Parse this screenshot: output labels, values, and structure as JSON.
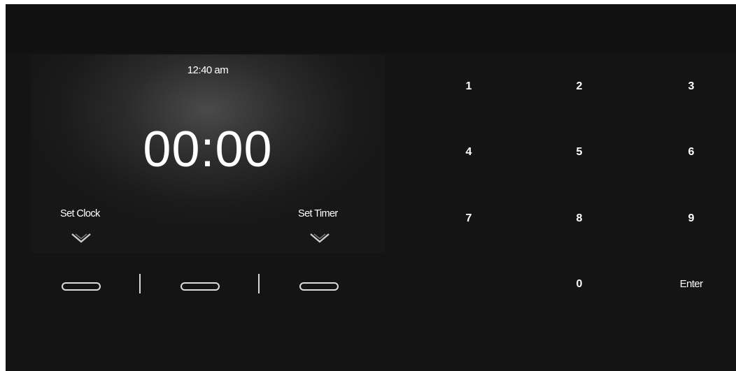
{
  "display": {
    "current_time": "12:40 am",
    "timer_value": "00:00",
    "left_softkey_label": "Set Clock",
    "right_softkey_label": "Set Timer"
  },
  "keypad": {
    "keys": [
      "1",
      "2",
      "3",
      "4",
      "5",
      "6",
      "7",
      "8",
      "9",
      "0"
    ],
    "enter_label": "Enter"
  },
  "colors": {
    "background": "#141414",
    "text": "#ffffff",
    "button_outline": "#dcdcdc"
  },
  "icons": {
    "softkey_arrow": "chevron-down-icon"
  }
}
